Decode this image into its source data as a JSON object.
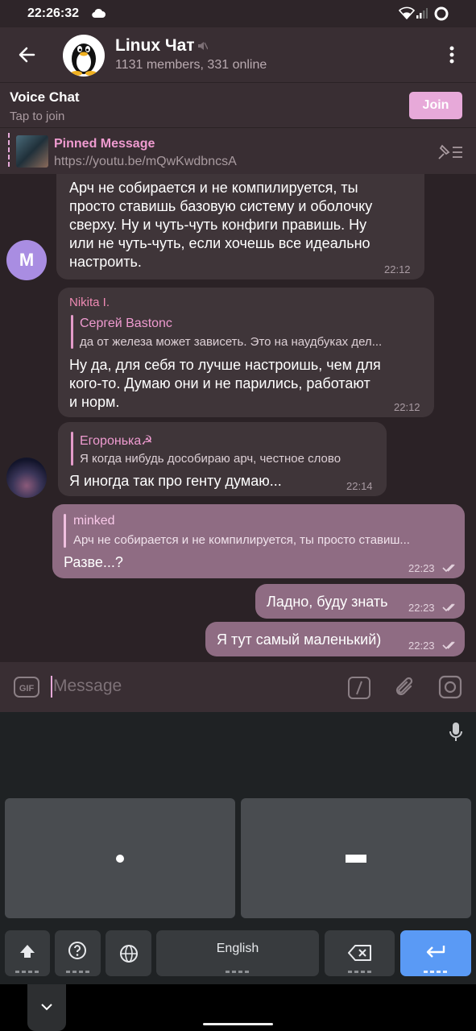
{
  "status_bar": {
    "time": "22:26:32"
  },
  "header": {
    "title": "Linux Чат",
    "subtitle": "1131 members, 331 online"
  },
  "voice_chat": {
    "title": "Voice Chat",
    "subtitle": "Tap to join",
    "join_label": "Join"
  },
  "pinned": {
    "title": "Pinned Message",
    "text": "https://youtu.be/mQwKwdbncsA"
  },
  "messages": [
    {
      "lines": [
        "Арч не собирается и не компилируется, ты",
        "просто ставишь базовую систему и оболочку",
        "сверху. Ну и чуть-чуть конфиги правишь. Ну",
        "или не чуть-чуть, если хочешь все идеально",
        "настроить."
      ],
      "time": "22:12",
      "avatar_letter": "M"
    },
    {
      "sender": "Nikita I.",
      "reply_name": "Сергей Bastonc",
      "reply_text": "да от железа может зависеть. Это на наудбуках дел...",
      "lines": [
        "Ну да, для себя то лучше настроишь, чем для",
        "кого-то. Думаю они и не парились, работают",
        "и норм."
      ],
      "time": "22:12"
    },
    {
      "reply_name": "Егоронька☭",
      "reply_text": "Я когда нибудь дособираю арч, честное слово",
      "lines": [
        "Я иногда так про генту думаю..."
      ],
      "time": "22:14"
    },
    {
      "reply_name": "minked",
      "reply_text": "Арч не собирается и не компилируется, ты просто ставиш...",
      "lines": [
        "Разве...?"
      ],
      "time": "22:23"
    },
    {
      "lines": [
        "Ладно, буду знать"
      ],
      "time": "22:23"
    },
    {
      "lines": [
        "Я тут самый маленький)"
      ],
      "time": "22:23"
    }
  ],
  "input": {
    "placeholder": "Message"
  },
  "keyboard": {
    "language_label": "English"
  },
  "colors": {
    "accent": "#e7a9d9",
    "outgoing_bubble": "#8f6c83",
    "incoming_bubble": "#3f3539",
    "enter_key": "#5a9af5"
  }
}
